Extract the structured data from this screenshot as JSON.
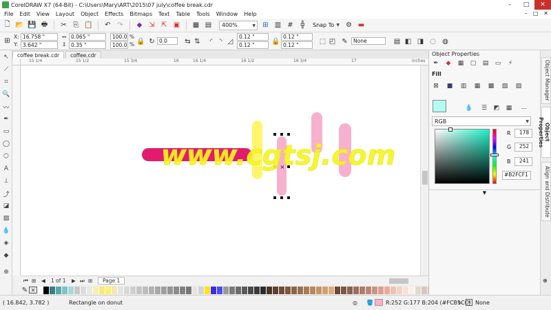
{
  "window": {
    "title": "CorelDRAW X7 (64-Bit) - C:\\Users\\Mary\\ART\\2015\\07 july\\coffee break.cdr",
    "minimize": "–",
    "maximize": "□",
    "close": "✕"
  },
  "menu": {
    "items": [
      "File",
      "Edit",
      "View",
      "Layout",
      "Object",
      "Effects",
      "Bitmaps",
      "Text",
      "Table",
      "Tools",
      "Window",
      "Help"
    ],
    "right_controls": [
      "–",
      "□",
      "✕"
    ]
  },
  "standard_toolbar": {
    "zoom_value": "400%",
    "snap_to_label": "Snap To"
  },
  "property_bar": {
    "x_label": "X:",
    "x_value": "16.758 \"",
    "y_label": "Y:",
    "y_value": "3.642 \"",
    "w_value": "0.065 \"",
    "h_value": "0.35 \"",
    "scale_w": "100.0",
    "scale_h": "100.0",
    "percent": "%",
    "rotation": "0.0",
    "corner_tl": "0.12 \"",
    "corner_bl": "0.12 \"",
    "corner_tr": "0.12 \"",
    "corner_br": "0.12 \"",
    "outline_value": "None"
  },
  "document_tabs": [
    "coffee break.cdr",
    "coffee.cdr"
  ],
  "ruler": {
    "labels": [
      "15 1/4",
      "15 1/2",
      "15 3/4",
      "16",
      "16 1/4",
      "16 1/2",
      "16 3/4",
      "17"
    ],
    "unit": "inches"
  },
  "watermark": {
    "text": "www.cgtsj.com"
  },
  "page_nav": {
    "page_count": "1 of 1",
    "page_tab": "Page 1"
  },
  "palette": {
    "colors": [
      "#ffffff",
      "#000000",
      "#3a7d82",
      "#5aa7ae",
      "#7fc1c4",
      "#a8d8d8",
      "#c8c8c8",
      "#dcdcdc",
      "#e8e8e8",
      "#f5f0b4",
      "#f7ea7a",
      "#fff06a",
      "#f4e6b4",
      "#e4e4e4",
      "#d8d8d8",
      "#cfcfcf",
      "#c4c4c4",
      "#bcbcbc",
      "#b2b2b2",
      "#a8a8a8",
      "#9e9e9e",
      "#949494",
      "#8a8a8a",
      "#808080",
      "#767676",
      "#e4e4e4",
      "#d4d4d4",
      "#ffe21a",
      "#3a2fe0",
      "#4a4ef0",
      "#9a9a9a",
      "#7a7a7a",
      "#6a6a6a",
      "#5a5a5a",
      "#4a4a4a",
      "#3a3a3a",
      "#2a2a2a",
      "#4a3428",
      "#5c4030",
      "#6e4c38",
      "#7c5840",
      "#8a6448",
      "#987050",
      "#a67c58",
      "#b48860",
      "#c29468",
      "#d0a070",
      "#deac78",
      "#6a4a3a",
      "#7a5646",
      "#8a6252",
      "#9a6e5e",
      "#aa7a6a",
      "#ba8676",
      "#ca9282",
      "#da9e8e",
      "#eaaa9a",
      "#f0c2b0",
      "#f4d2c4",
      "#f8e2d8",
      "#fcf0ea",
      "#e6d6ce",
      "#d6c6be",
      "#c6b6ae",
      "#b6a69e",
      "#a6968e",
      "#96867e",
      "#86766e",
      "#76665e",
      "#66564e",
      "#58484a",
      "#6a5860",
      "#7c6876",
      "#8e788c",
      "#a088a2",
      "#b298b8",
      "#c4a8ce",
      "#d6b8e4",
      "#e8c8fa",
      "#ffffff",
      "#eeeeee"
    ]
  },
  "status": {
    "coords": "( 16.842, 3.782 )",
    "object_info": "Rectangle on donut",
    "fill_info": "R:252 G:177 B:204 (#FCB1CC)",
    "outline_info": "None"
  },
  "object_properties": {
    "title": "Object Properties",
    "section": "Fill",
    "color_model": "RGB",
    "r_label": "R",
    "r_value": "178",
    "g_label": "G",
    "g_value": "252",
    "b_label": "B",
    "b_value": "241",
    "hex_value": "#B2FCF1",
    "swatch_color": "#b2fcf1",
    "more_dots": "..."
  },
  "side_tabs": [
    "Object Manager",
    "Object Properties",
    "Align and Distribute"
  ]
}
